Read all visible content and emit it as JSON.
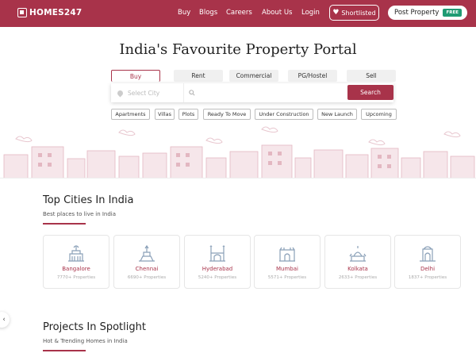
{
  "header": {
    "logo_text": "HOMES247",
    "nav": [
      "Buy",
      "Blogs",
      "Careers",
      "About Us",
      "Login"
    ],
    "shortlisted_label": "Shortlisted",
    "post_label": "Post Property",
    "free_badge": "FREE"
  },
  "hero": {
    "title": "India's Favourite Property Portal",
    "tabs": [
      "Buy",
      "Rent",
      "Commercial",
      "PG/Hostel",
      "Sell"
    ],
    "active_tab": "Buy",
    "city_placeholder": "Select City",
    "search_placeholder": "",
    "search_button": "Search",
    "chips": [
      "Apartments",
      "Villas",
      "Plots",
      "Ready To Move",
      "Under Construction",
      "New Launch",
      "Upcoming"
    ]
  },
  "top_cities": {
    "title": "Top Cities In India",
    "subtitle": "Best places to live in India",
    "cities": [
      {
        "name": "Bangalore",
        "count": "7770+ Properties"
      },
      {
        "name": "Chennai",
        "count": "6690+ Properties"
      },
      {
        "name": "Hyderabad",
        "count": "5240+ Properties"
      },
      {
        "name": "Mumbai",
        "count": "5571+ Properties"
      },
      {
        "name": "Kolkata",
        "count": "2633+ Properties"
      },
      {
        "name": "Delhi",
        "count": "1837+ Properties"
      }
    ]
  },
  "projects": {
    "title": "Projects In Spotlight",
    "subtitle": "Hot & Trending Homes in India"
  },
  "colors": {
    "brand": "#a8334a",
    "free_badge": "#1f9b73"
  }
}
